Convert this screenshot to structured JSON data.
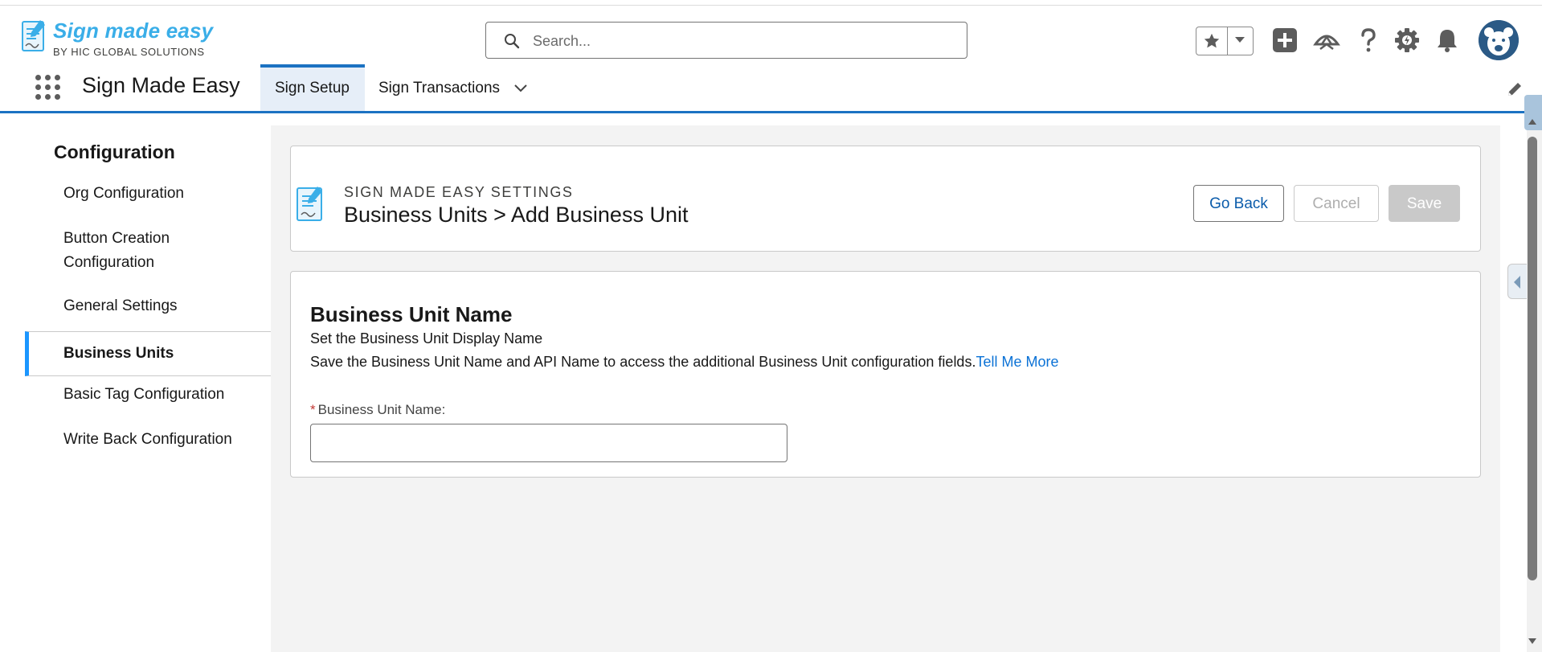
{
  "brand": {
    "logo_main": "Sign made easy",
    "logo_sub": "BY HIC GLOBAL SOLUTIONS"
  },
  "search": {
    "placeholder": "Search..."
  },
  "header_icons": [
    "star-icon",
    "chevron-down-icon",
    "add-icon",
    "trailhead-icon",
    "help-icon",
    "setup-gear-icon",
    "bell-icon",
    "avatar"
  ],
  "app": {
    "name": "Sign Made Easy",
    "tabs": [
      {
        "label": "Sign Setup",
        "active": true
      },
      {
        "label": "Sign Transactions",
        "active": false
      }
    ]
  },
  "sidebar": {
    "title": "Configuration",
    "items": [
      {
        "label": "Org Configuration"
      },
      {
        "label": "Button Creation Configuration"
      },
      {
        "label": "General Settings"
      },
      {
        "label": "Business Units",
        "active": true
      },
      {
        "label": "Basic Tag Configuration"
      },
      {
        "label": "Write Back Configuration"
      }
    ]
  },
  "page_header": {
    "eyebrow": "SIGN MADE EASY SETTINGS",
    "title": "Business Units > Add Business Unit",
    "buttons": {
      "back": "Go Back",
      "cancel": "Cancel",
      "save": "Save"
    }
  },
  "form": {
    "title": "Business Unit Name",
    "subtitle": "Set the Business Unit Display Name",
    "description": "Save the Business Unit Name and API Name to access the additional Business Unit configuration fields.",
    "link": "Tell Me More",
    "field_label": "Business Unit Name:",
    "required_marker": "*",
    "field_value": ""
  },
  "colors": {
    "brand_blue": "#1b72c2",
    "link_blue": "#0b72d6",
    "logo_blue": "#3aaee8",
    "required_red": "#c23934"
  }
}
